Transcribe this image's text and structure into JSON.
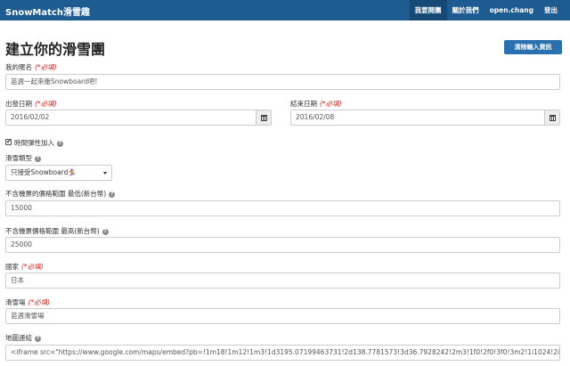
{
  "brand": "SnowMatch滑雪趣",
  "nav": {
    "items": [
      "我要開團",
      "關於我們",
      "open.chang",
      "登出"
    ],
    "active_index": 0
  },
  "page": {
    "title": "建立你的滑雪團",
    "clear_button": "清除輸入資訊"
  },
  "required_mark": "(*必填)",
  "form": {
    "name": {
      "label": "我的暱名",
      "value": "苗週一起來衝Snowboard吧!"
    },
    "start_date": {
      "label": "出發日期",
      "value": "2016/02/02"
    },
    "end_date": {
      "label": "結束日期",
      "value": "2016/02/08"
    },
    "flexible": {
      "label": "時間彈性加入",
      "checked": true,
      "mark": "✔"
    },
    "ski_type": {
      "label": "滑雪類型",
      "value": "只接受Snowboard🏂"
    },
    "price_min": {
      "label": "不含機票的價格範圍 最低(新台幣)",
      "value": "15000"
    },
    "price_max": {
      "label": "不含機票價格範圍 最高(新台幣)",
      "value": "25000"
    },
    "country": {
      "label": "國家",
      "value": "日本"
    },
    "resort": {
      "label": "滑雪場",
      "value": "苗週滑雪場"
    },
    "map_link": {
      "label": "地圖連結",
      "value": "<iframe src=\"https://www.google.com/maps/embed?pb=!1m18!1m12!1m3!1d3195.07199463731!2d138.7781573!3d36.7928242!2m3!1f0!2f0!3f0!3m2!1i1024!2i768!4f13.1!3m3"
    }
  },
  "icons": {
    "help": "question-circle-icon",
    "calendar": "calendar-icon",
    "dropdown": "caret-down-icon"
  }
}
